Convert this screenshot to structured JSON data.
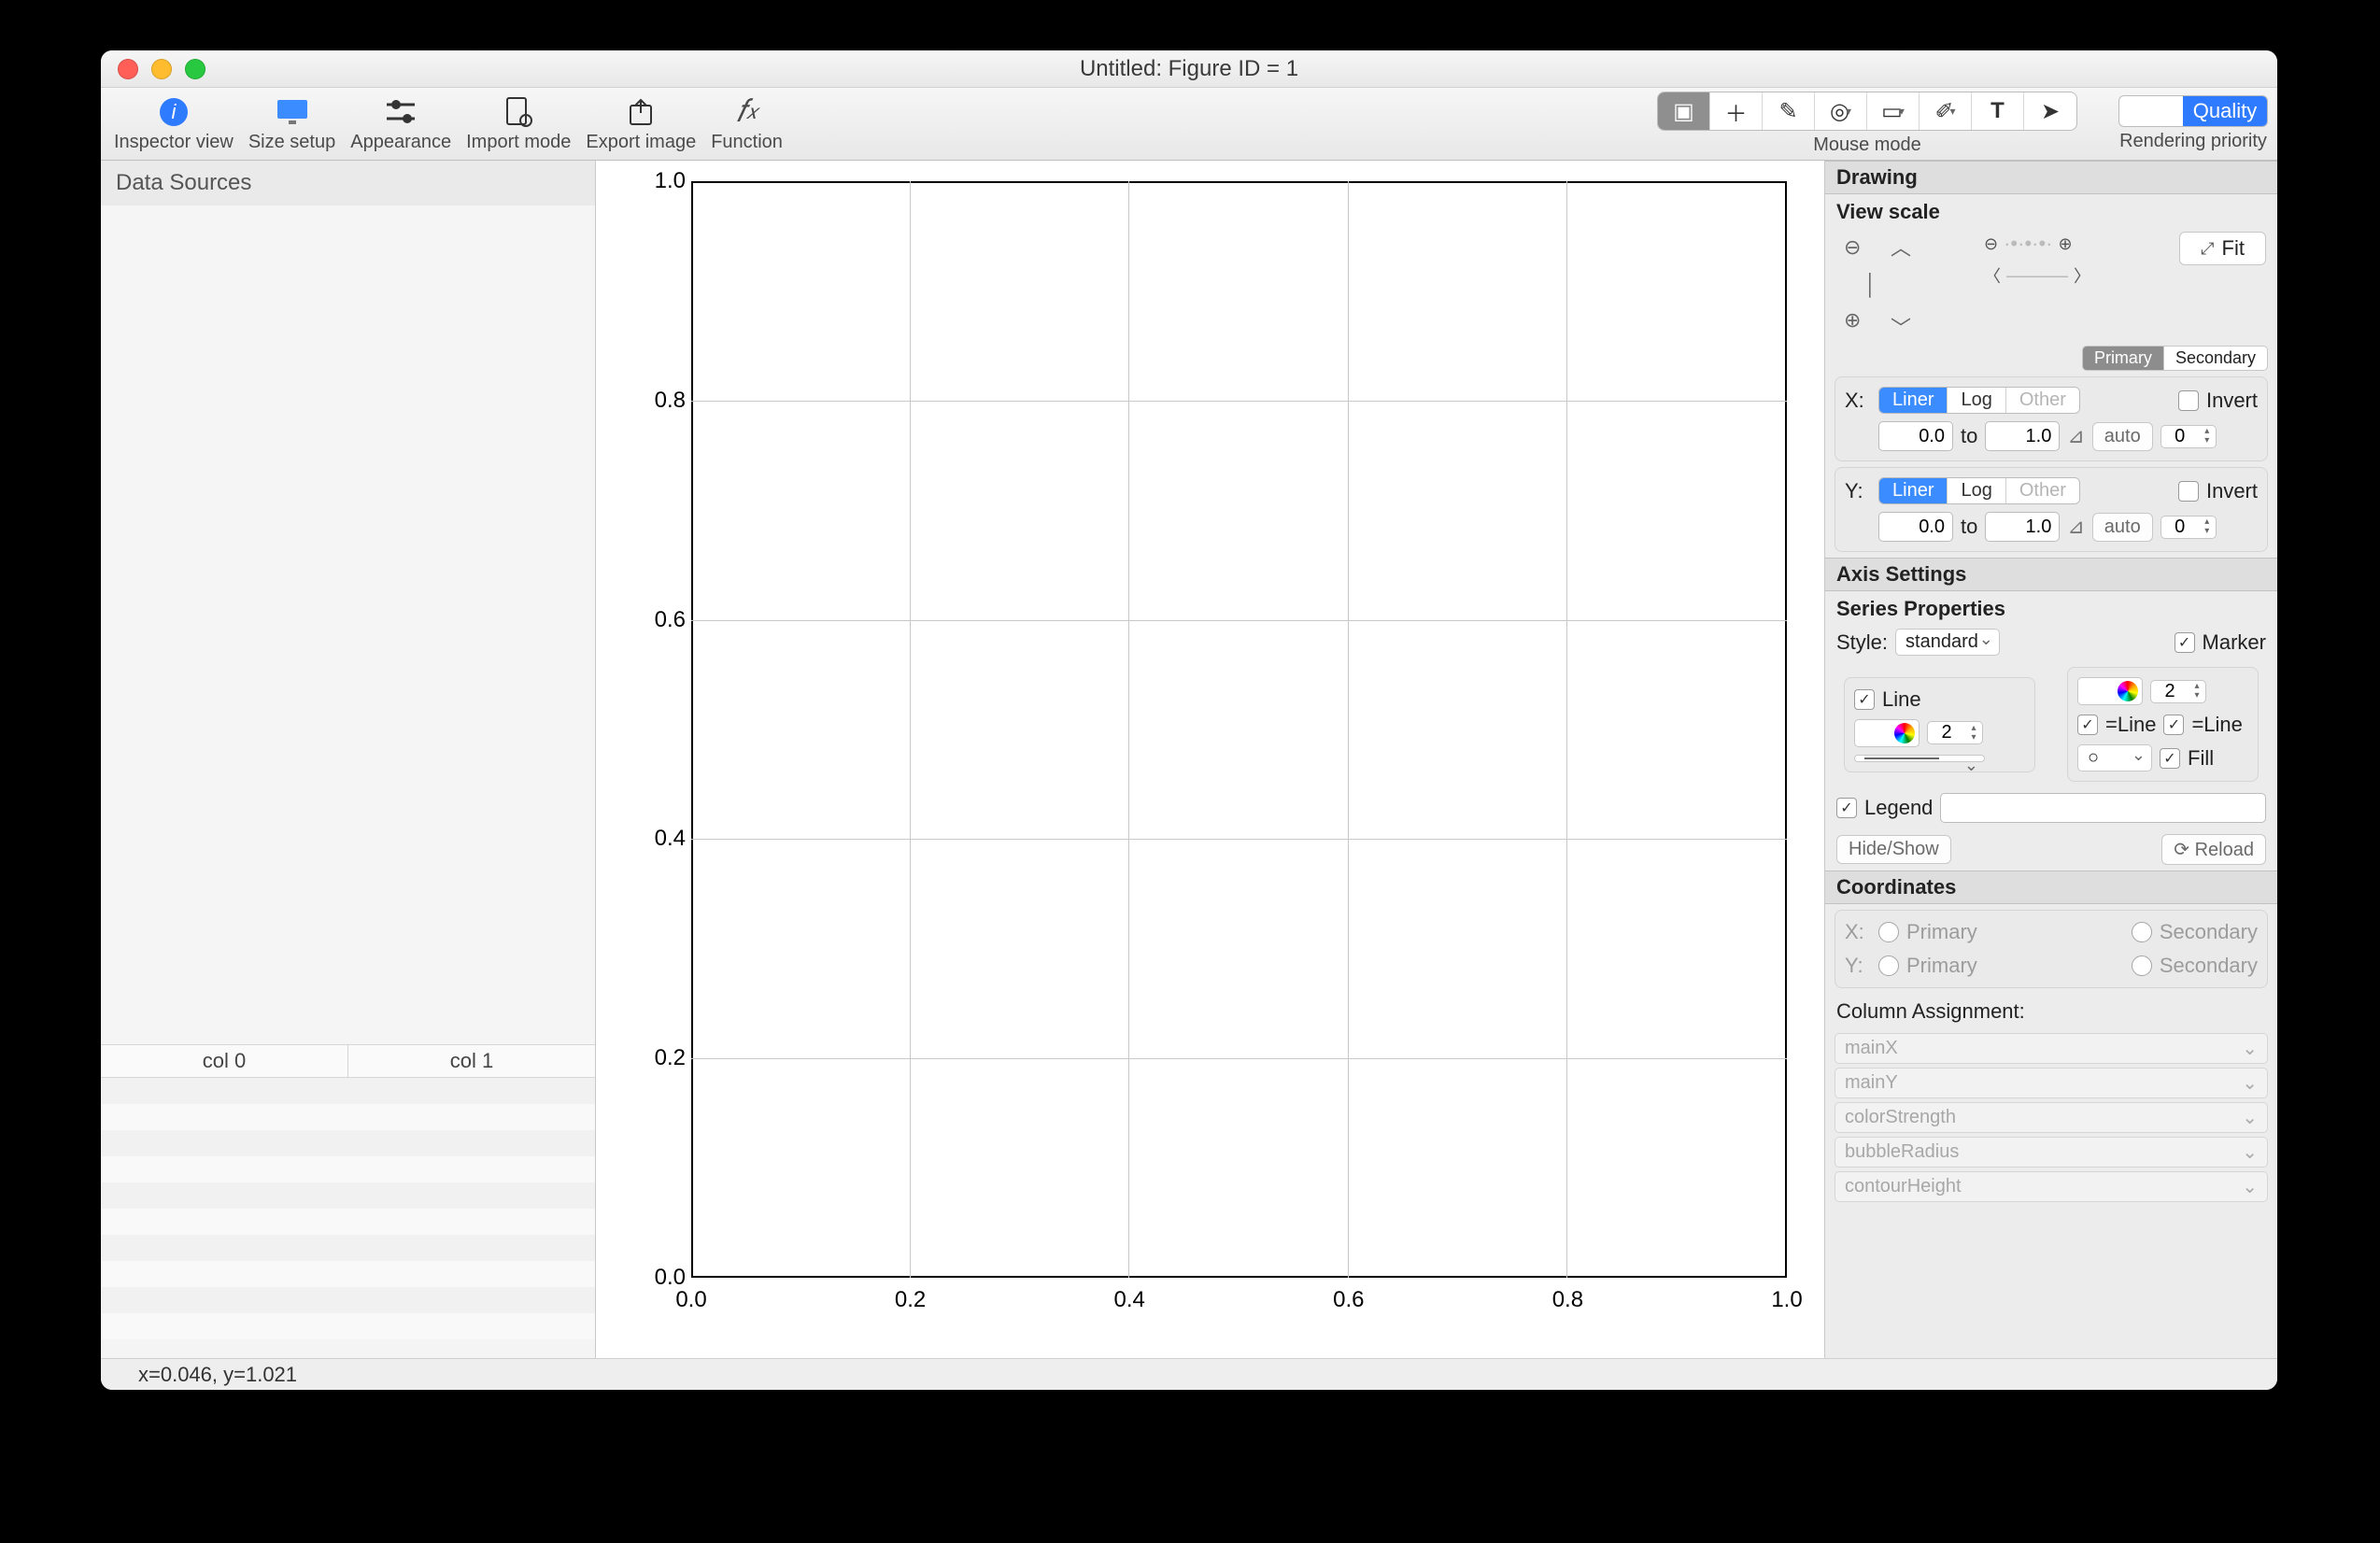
{
  "window": {
    "title": "Untitled: Figure ID = 1"
  },
  "toolbar": {
    "items": [
      {
        "label": "Inspector view",
        "icon": "ℹ️"
      },
      {
        "label": "Size setup",
        "icon": "🖥"
      },
      {
        "label": "Appearance",
        "icon": "⚙"
      },
      {
        "label": "Import mode",
        "icon": "📄"
      },
      {
        "label": "Export image",
        "icon": "⇪"
      },
      {
        "label": "Function",
        "icon": "𝑓ₓ"
      }
    ],
    "mouse_mode_label": "Mouse mode",
    "rendering_label": "Rendering priority",
    "quality_label": "Quality"
  },
  "left": {
    "header": "Data Sources",
    "columns": [
      "col 0",
      "col 1"
    ]
  },
  "chart_data": {
    "type": "scatter",
    "title": "",
    "xlabel": "",
    "ylabel": "",
    "xlim": [
      0.0,
      1.0
    ],
    "ylim": [
      0.0,
      1.0
    ],
    "xticks": [
      0.0,
      0.2,
      0.4,
      0.6,
      0.8,
      1.0
    ],
    "yticks": [
      0.0,
      0.2,
      0.4,
      0.6,
      0.8,
      1.0
    ],
    "series": []
  },
  "inspector": {
    "drawing_header": "Drawing",
    "view_scale_header": "View scale",
    "fit_label": "Fit",
    "tabs": {
      "primary": "Primary",
      "secondary": "Secondary"
    },
    "x": {
      "label": "X:",
      "scale_options": [
        "Liner",
        "Log",
        "Other"
      ],
      "scale_active": "Liner",
      "invert_label": "Invert",
      "from": "0.0",
      "to_label": "to",
      "to": "1.0",
      "auto_label": "auto",
      "digits": "0"
    },
    "y": {
      "label": "Y:",
      "scale_options": [
        "Liner",
        "Log",
        "Other"
      ],
      "scale_active": "Liner",
      "invert_label": "Invert",
      "from": "0.0",
      "to_label": "to",
      "to": "1.0",
      "auto_label": "auto",
      "digits": "0"
    },
    "axis_settings_header": "Axis Settings",
    "series_props_header": "Series Properties",
    "style_label": "Style:",
    "style_value": "standard",
    "marker_label": "Marker",
    "line_label": "Line",
    "line_width": "2",
    "marker_size": "2",
    "eq_line_label": "=Line",
    "fill_label": "Fill",
    "legend_label": "Legend",
    "hide_show_label": "Hide/Show",
    "reload_label": "Reload",
    "coords_header": "Coordinates",
    "coords_x_label": "X:",
    "coords_y_label": "Y:",
    "primary_label": "Primary",
    "secondary_label": "Secondary",
    "column_assignment_header": "Column Assignment:",
    "assignments": [
      "mainX",
      "mainY",
      "colorStrength",
      "bubbleRadius",
      "contourHeight"
    ]
  },
  "status": {
    "text": "x=0.046, y=1.021"
  }
}
